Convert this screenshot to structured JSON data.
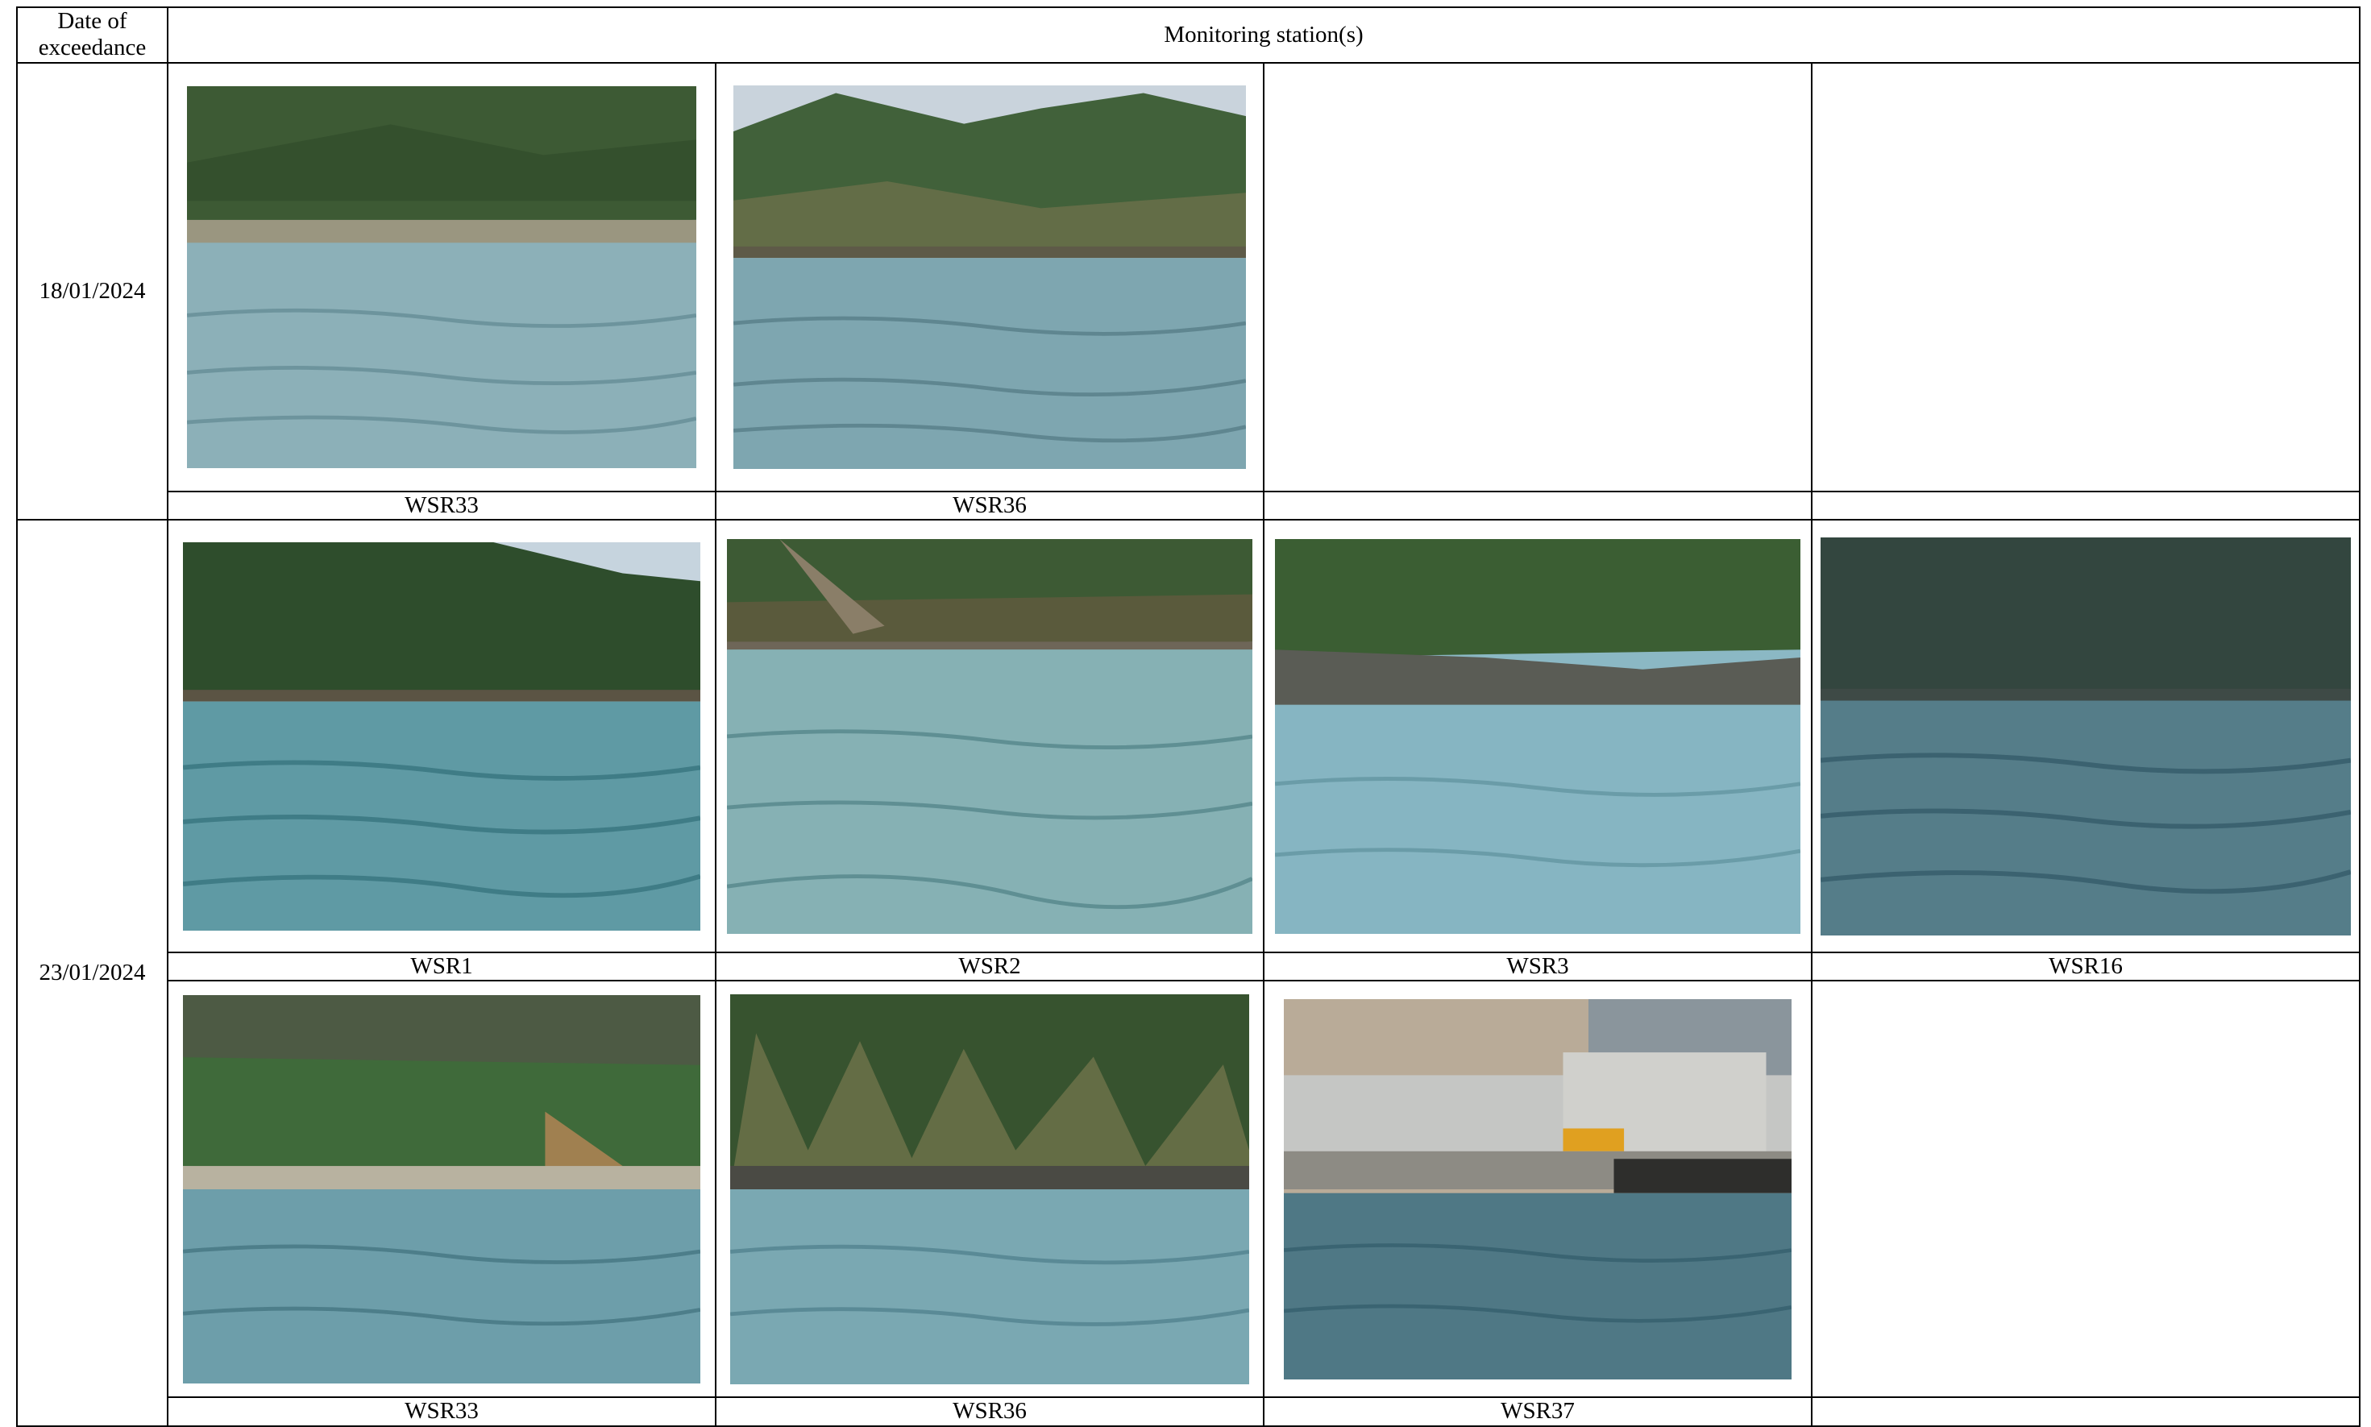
{
  "header": {
    "date_column": "Date of exceedance",
    "station_column": "Monitoring station(s)"
  },
  "groups": [
    {
      "date": "18/01/2024",
      "rows": [
        [
          {
            "label": "WSR33",
            "photo": "coastal-water-photo"
          },
          {
            "label": "WSR36",
            "photo": "coastal-water-photo"
          },
          {
            "label": "",
            "photo": null
          },
          {
            "label": "",
            "photo": null
          }
        ]
      ]
    },
    {
      "date": "23/01/2024",
      "rows": [
        [
          {
            "label": "WSR1",
            "photo": "coastal-water-photo"
          },
          {
            "label": "WSR2",
            "photo": "coastal-water-photo"
          },
          {
            "label": "WSR3",
            "photo": "coastal-water-photo"
          },
          {
            "label": "WSR16",
            "photo": "coastal-water-photo"
          }
        ],
        [
          {
            "label": "WSR33",
            "photo": "coastal-water-photo"
          },
          {
            "label": "WSR36",
            "photo": "coastal-water-photo"
          },
          {
            "label": "WSR37",
            "photo": "pier-construction-photo"
          },
          {
            "label": "",
            "photo": null
          }
        ]
      ]
    }
  ]
}
